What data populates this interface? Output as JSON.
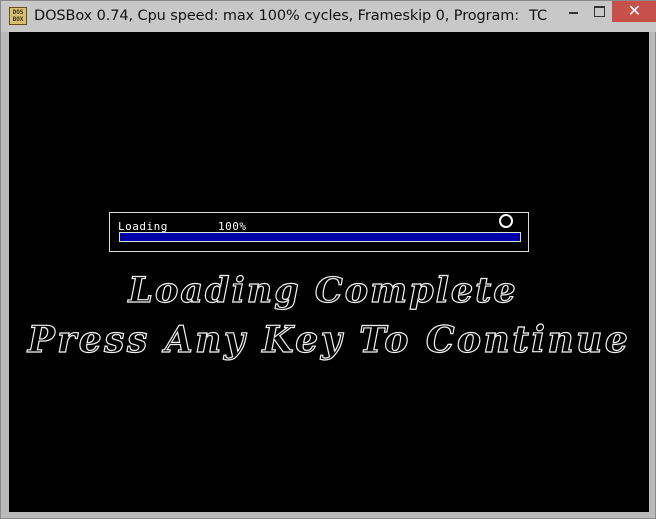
{
  "window": {
    "title": "DOSBox 0.74, Cpu speed: max 100% cycles, Frameskip  0, Program:",
    "title_tail": "TC",
    "icon_text": "DOS\nBOX",
    "controls": {
      "minimize_label": "",
      "maximize_label": "",
      "close_label": "✕"
    }
  },
  "loader": {
    "label": "Loading",
    "percent_text": "100%",
    "progress": 1.0,
    "fill_color": "#0000a8"
  },
  "messages": {
    "line1": "Loading Complete",
    "line2": "Press Any Key To Continue"
  },
  "colors": {
    "screen_bg": "#000000",
    "titlebar_bg": "#c8c8c8",
    "close_button": "#c7504a"
  }
}
